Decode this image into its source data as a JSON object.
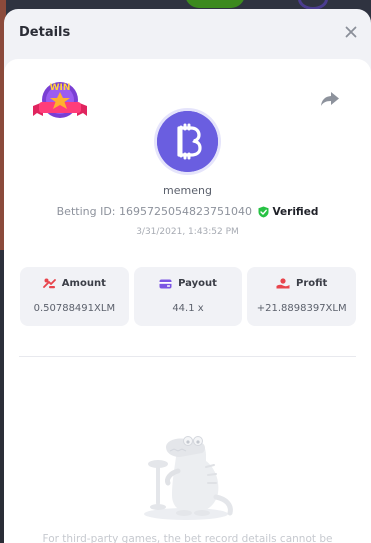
{
  "modal": {
    "title": "Details"
  },
  "bet": {
    "username": "memeng",
    "betting_id_label": "Betting ID: ",
    "betting_id": "1695725054823751040",
    "verified_label": "Verified",
    "timestamp": "3/31/2021, 1:43:52 PM"
  },
  "stats": [
    {
      "label": "Amount",
      "value": "0.50788491XLM",
      "icon": "amount-icon"
    },
    {
      "label": "Payout",
      "value": "44.1 x",
      "icon": "payout-icon"
    },
    {
      "label": "Profit",
      "value": "+21.8898397XLM",
      "icon": "profit-icon"
    }
  ],
  "badge": {
    "text": "WIN"
  },
  "note": "For third-party games, the bet record details cannot be",
  "colors": {
    "accent": "#6a5ee0",
    "verified": "#27c244",
    "stat_icon": "#e8444c",
    "payout_icon": "#7b55e3"
  }
}
